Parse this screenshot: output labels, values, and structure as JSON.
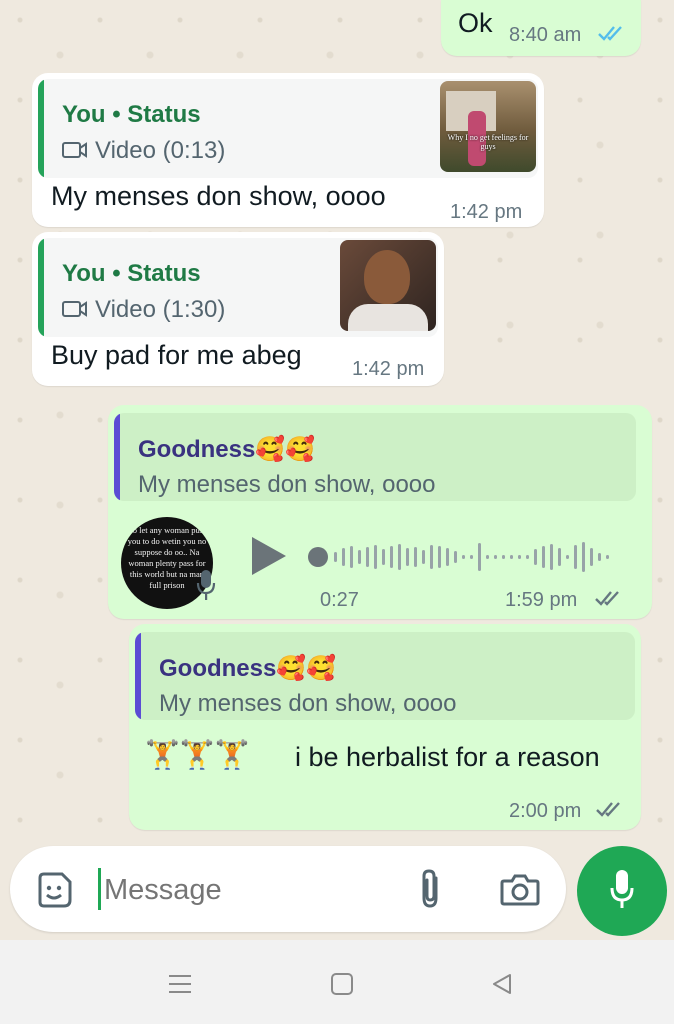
{
  "messages": {
    "ok": {
      "text": "Ok",
      "time": "8:40 am",
      "ticks_color": "#53bdeb"
    },
    "status1": {
      "quote_title": "You • Status",
      "quote_sub": "Video (0:13)",
      "thumb_caption": "Why I no get feelings for guys",
      "text": "My menses don show, oooo",
      "time": "1:42 pm"
    },
    "status2": {
      "quote_title": "You • Status",
      "quote_sub": "Video (1:30)",
      "text": "Buy pad for me abeg",
      "time": "1:42 pm"
    },
    "voice": {
      "quote_title": "Goodness🥰🥰",
      "quote_sub": "My menses don show, oooo",
      "avatar_text": "No let any woman push you to do wetin you no suppose do oo.. Na woman plenty pass for this world but na man full prison",
      "duration": "0:27",
      "time": "1:59 pm"
    },
    "herbalist": {
      "quote_title": "Goodness🥰🥰",
      "quote_sub": "My menses don show, oooo",
      "emoji": "🏋🏋🏋",
      "text": "i be herbalist for a reason",
      "time": "2:00 pm"
    }
  },
  "composer": {
    "placeholder": "Message",
    "icons": [
      "sticker-icon",
      "attach-icon",
      "camera-icon",
      "mic-icon"
    ]
  },
  "colors": {
    "accent_green": "#1fa855",
    "quote_in_bar": "#25a35a",
    "quote_out_bar": "#5b4cd4",
    "read_ticks": "#53bdeb"
  }
}
